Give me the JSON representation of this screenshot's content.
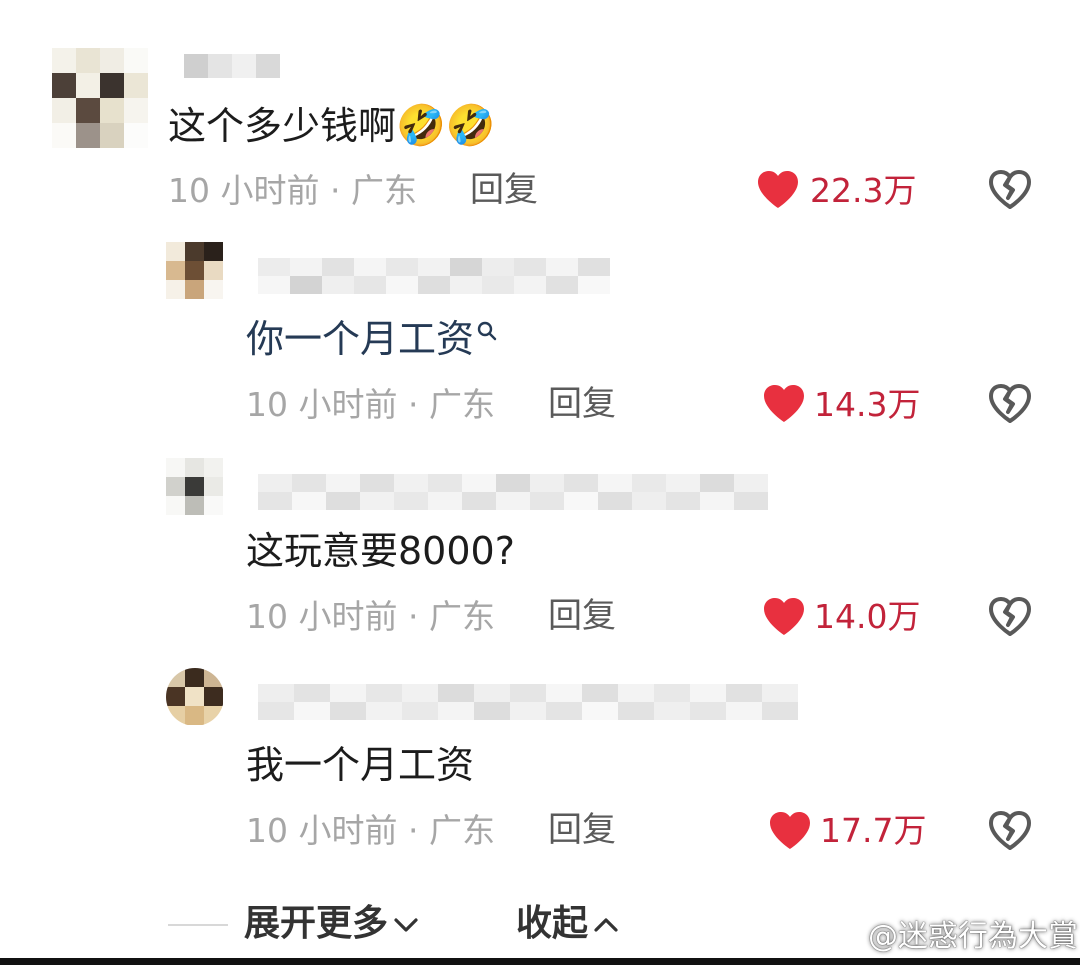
{
  "comments": [
    {
      "text": "这个多少钱啊",
      "emoji": [
        "🤣",
        "🤣"
      ],
      "time_location": "10 小时前 · 广东",
      "reply_label": "回复",
      "likes": "22.3万"
    },
    {
      "text": "你一个月工资",
      "search_hint_icon": "search-icon",
      "time_location": "10 小时前 · 广东",
      "reply_label": "回复",
      "likes": "14.3万"
    },
    {
      "text": "这玩意要8000?",
      "time_location": "10 小时前 · 广东",
      "reply_label": "回复",
      "likes": "14.0万"
    },
    {
      "text": "我一个月工资",
      "time_location": "10 小时前 · 广东",
      "reply_label": "回复",
      "likes": "17.7万"
    }
  ],
  "footer": {
    "expand_label": "展开更多",
    "collapse_label": "收起"
  },
  "watermark": "@迷惑行為大賞",
  "colors": {
    "like_red": "#e8303f",
    "meta_gray": "#a6a6a6",
    "link_blue": "#253a55"
  }
}
